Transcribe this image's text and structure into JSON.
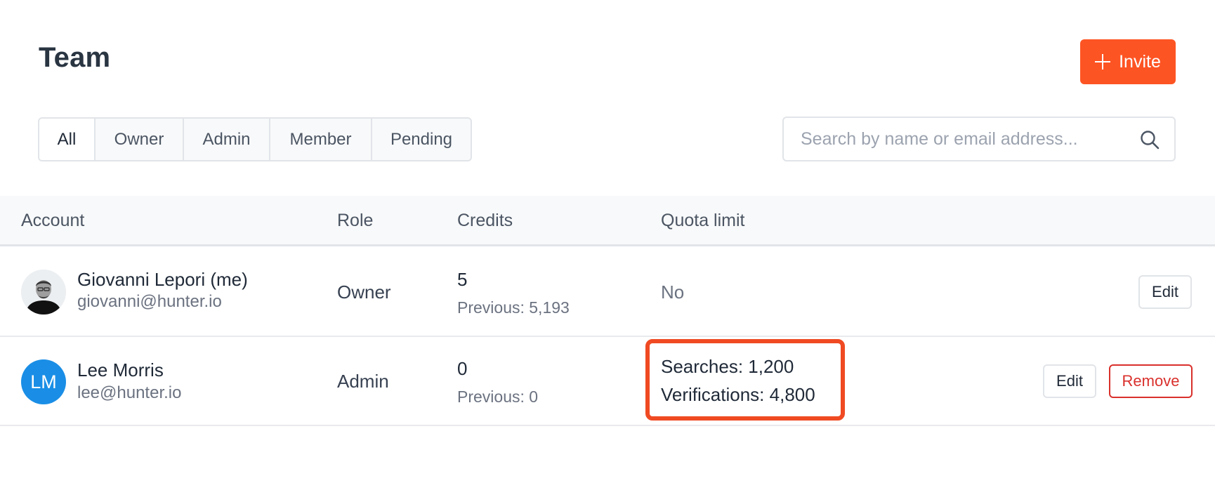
{
  "header": {
    "title": "Team",
    "invite_label": "Invite",
    "invite_icon": "plus-icon"
  },
  "filters": {
    "tabs": [
      "All",
      "Owner",
      "Admin",
      "Member",
      "Pending"
    ],
    "selected": "All"
  },
  "search": {
    "placeholder": "Search by name or email address...",
    "value": "",
    "icon": "search-icon"
  },
  "table": {
    "columns": [
      "Account",
      "Role",
      "Credits",
      "Quota limit"
    ],
    "rows": [
      {
        "name": "Giovanni Lepori (me)",
        "email": "giovanni@hunter.io",
        "avatar": "photo",
        "role": "Owner",
        "credits": "5",
        "previous": "Previous: 5,193",
        "quota": "No",
        "edit_label": "Edit"
      },
      {
        "name": "Lee Morris",
        "email": "lee@hunter.io",
        "avatar_initials": "LM",
        "role": "Admin",
        "credits": "0",
        "previous": "Previous: 0",
        "quota_searches": "Searches: 1,200",
        "quota_verifications": "Verifications: 4,800",
        "edit_label": "Edit",
        "remove_label": "Remove"
      }
    ]
  },
  "colors": {
    "accent": "#fd5423",
    "highlight_border": "#f04a23",
    "avatar_bg": "#1a8ee6",
    "danger": "#d9302c"
  }
}
